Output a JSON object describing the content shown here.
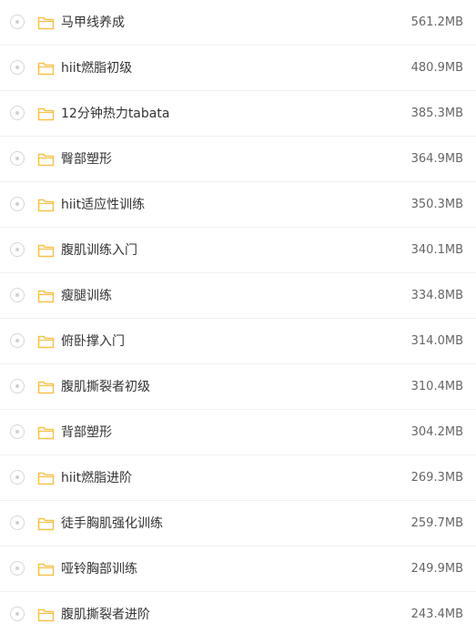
{
  "colors": {
    "folder": "#f8c14a",
    "text": "#333333",
    "size_text": "#666666",
    "divider": "#f1f1f1",
    "radio_border": "#d6d6d6"
  },
  "icons": {
    "select": "radio-circle-icon",
    "folder": "folder-icon"
  },
  "files": [
    {
      "name": "马甲线养成",
      "size": "561.2MB"
    },
    {
      "name": "hiit燃脂初级",
      "size": "480.9MB"
    },
    {
      "name": "12分钟热力tabata",
      "size": "385.3MB"
    },
    {
      "name": "臀部塑形",
      "size": "364.9MB"
    },
    {
      "name": "hiit适应性训练",
      "size": "350.3MB"
    },
    {
      "name": "腹肌训练入门",
      "size": "340.1MB"
    },
    {
      "name": "瘦腿训练",
      "size": "334.8MB"
    },
    {
      "name": "俯卧撑入门",
      "size": "314.0MB"
    },
    {
      "name": "腹肌撕裂者初级",
      "size": "310.4MB"
    },
    {
      "name": "背部塑形",
      "size": "304.2MB"
    },
    {
      "name": "hiit燃脂进阶",
      "size": "269.3MB"
    },
    {
      "name": "徒手胸肌强化训练",
      "size": "259.7MB"
    },
    {
      "name": "哑铃胸部训练",
      "size": "249.9MB"
    },
    {
      "name": "腹肌撕裂者进阶",
      "size": "243.4MB"
    }
  ]
}
